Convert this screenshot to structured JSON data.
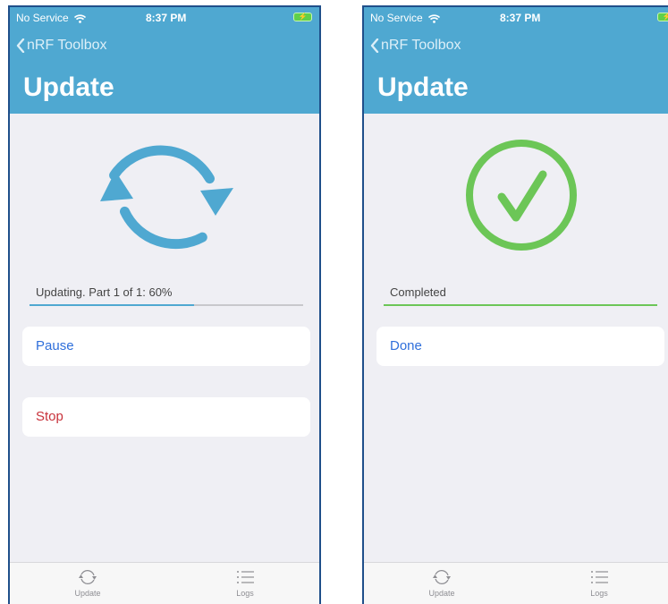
{
  "screens": [
    {
      "status": {
        "carrier": "No Service",
        "time": "8:37 PM"
      },
      "nav": {
        "back_label": "nRF Toolbox",
        "title": "Update"
      },
      "progress": {
        "label": "Updating. Part 1 of 1: 60%",
        "value": 0.6,
        "color": "#4fa8d1"
      },
      "actions": [
        {
          "label": "Pause",
          "color": "#2f6fdb"
        },
        {
          "label": "Stop",
          "color": "#c8323b"
        }
      ],
      "tabs": [
        {
          "label": "Update"
        },
        {
          "label": "Logs"
        }
      ]
    },
    {
      "status": {
        "carrier": "No Service",
        "time": "8:37 PM"
      },
      "nav": {
        "back_label": "nRF Toolbox",
        "title": "Update"
      },
      "progress": {
        "label": "Completed",
        "value": 1.0,
        "color": "#6cc657"
      },
      "actions": [
        {
          "label": "Done",
          "color": "#2f6fdb"
        }
      ],
      "tabs": [
        {
          "label": "Update"
        },
        {
          "label": "Logs"
        }
      ]
    }
  ],
  "colors": {
    "nav_background": "#4fa8d1",
    "sync_icon": "#4fa8d1",
    "check_icon": "#6cc657"
  }
}
